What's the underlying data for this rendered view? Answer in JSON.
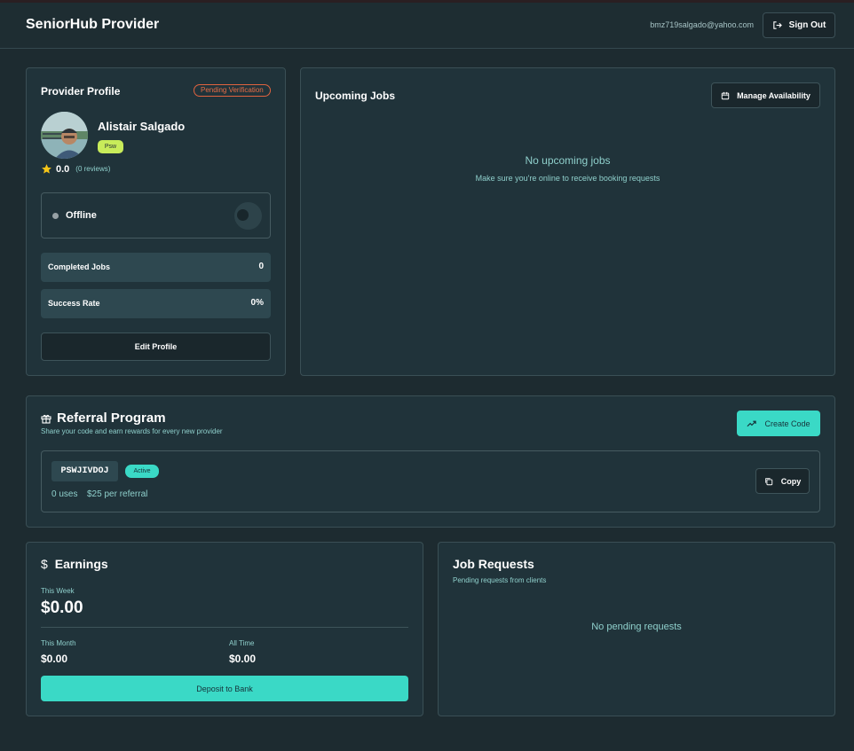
{
  "header": {
    "brand": "SeniorHub Provider",
    "email": "bmz719salgado@yahoo.com",
    "sign_out": "Sign Out"
  },
  "profile": {
    "title": "Provider Profile",
    "verification_badge": "Pending Verification",
    "name": "Alistair Salgado",
    "role_badge": "Psw",
    "rating": "0.0",
    "reviews": "(0 reviews)",
    "status": "Offline",
    "stats": [
      {
        "label": "Completed Jobs",
        "value": "0"
      },
      {
        "label": "Success Rate",
        "value": "0%"
      }
    ],
    "edit_button": "Edit Profile"
  },
  "upcoming": {
    "title": "Upcoming Jobs",
    "manage_button": "Manage Availability",
    "empty_title": "No upcoming jobs",
    "empty_sub": "Make sure you're online to receive booking requests"
  },
  "referral": {
    "title": "Referral Program",
    "subtitle": "Share your code and earn rewards for every new provider",
    "create_button": "Create Code",
    "code": "PSWJIVDOJ",
    "code_status": "Active",
    "uses": "0 uses",
    "reward": "$25 per referral",
    "copy_button": "Copy"
  },
  "earnings": {
    "title": "Earnings",
    "this_week_label": "This Week",
    "this_week": "$0.00",
    "this_month_label": "This Month",
    "this_month": "$0.00",
    "all_time_label": "All Time",
    "all_time": "$0.00",
    "deposit_button": "Deposit to Bank"
  },
  "job_requests": {
    "title": "Job Requests",
    "subtitle": "Pending requests from clients",
    "empty": "No pending requests"
  },
  "colors": {
    "background": "#1d2b30",
    "card": "#20333a",
    "accent": "#3ad9c6",
    "pending": "#e76d46",
    "psw_badge": "#c8ec5a",
    "star": "#f5c518"
  }
}
